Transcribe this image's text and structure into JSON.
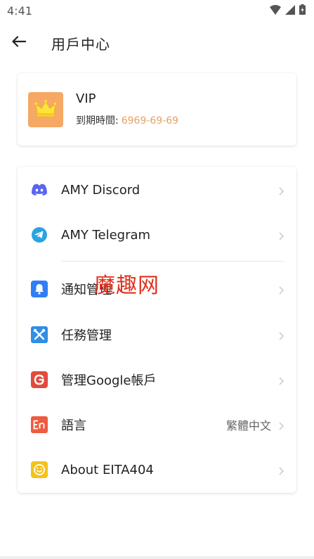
{
  "status": {
    "time": "4:41"
  },
  "header": {
    "title": "用戶中心"
  },
  "vip": {
    "level": "VIP",
    "expiry_label": "到期時間:",
    "expiry_date": "6969-69-69"
  },
  "menu": [
    {
      "label": "AMY Discord",
      "icon": "discord-icon"
    },
    {
      "label": "AMY Telegram",
      "icon": "telegram-icon"
    },
    {
      "label": "通知管理",
      "icon": "bell-icon"
    },
    {
      "label": "任務管理",
      "icon": "tools-icon"
    },
    {
      "label": "管理Google帳戶",
      "icon": "google-icon"
    },
    {
      "label": "語言",
      "icon": "language-icon",
      "value": "繁體中文"
    },
    {
      "label": "About EITA404",
      "icon": "smiley-icon"
    }
  ],
  "watermark": "魔趣网",
  "colors": {
    "accent": "#e8a160",
    "vip_badge": "#f6a964",
    "discord": "#5865f2",
    "telegram": "#2aa3e0",
    "bell": "#2f7ef5",
    "tools": "#2f8ee8",
    "google": "#e04b3e",
    "language": "#ee5b3f",
    "smiley": "#f5c21b",
    "watermark": "#e0301e"
  }
}
